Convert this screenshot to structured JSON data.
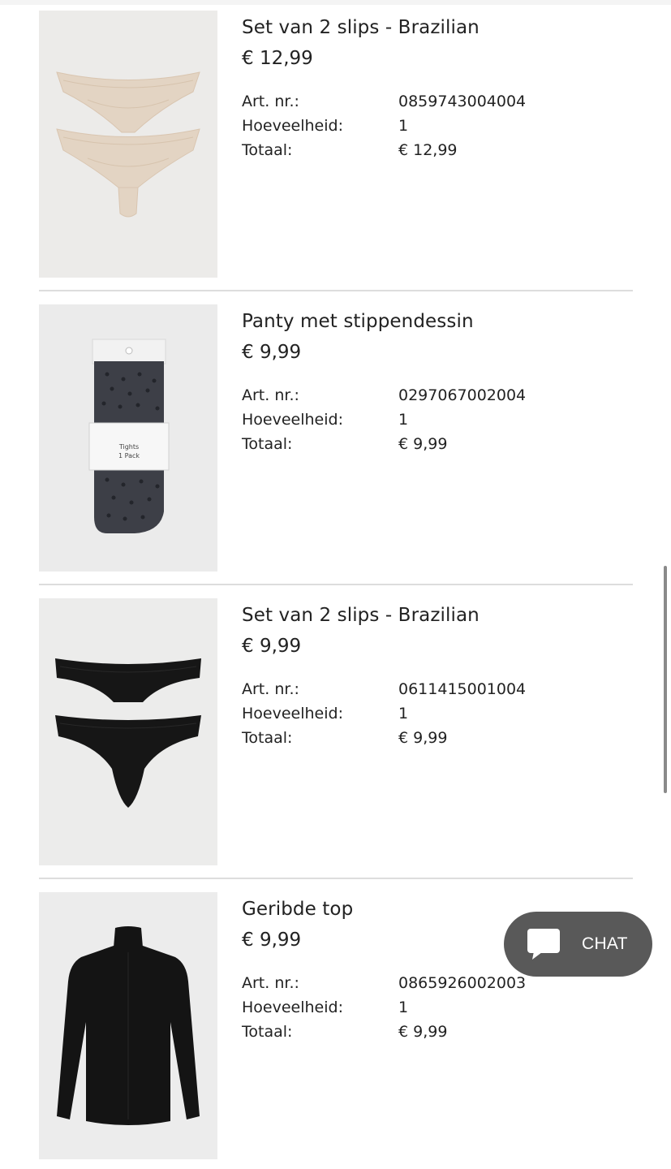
{
  "items": [
    {
      "name": "Set van 2 slips - Brazilian",
      "price": "€ 12,99",
      "art_label": "Art. nr.:",
      "art_value": "0859743004004",
      "qty_label": "Hoeveelheid:",
      "qty_value": "1",
      "total_label": "Totaal:",
      "total_value": "€ 12,99"
    },
    {
      "name": "Panty met stippendessin",
      "price": "€ 9,99",
      "art_label": "Art. nr.:",
      "art_value": "0297067002004",
      "qty_label": "Hoeveelheid:",
      "qty_value": "1",
      "total_label": "Totaal:",
      "total_value": "€ 9,99",
      "pack_label_line1": "Tights",
      "pack_label_line2": "1 Pack"
    },
    {
      "name": "Set van 2 slips - Brazilian",
      "price": "€ 9,99",
      "art_label": "Art. nr.:",
      "art_value": "0611415001004",
      "qty_label": "Hoeveelheid:",
      "qty_value": "1",
      "total_label": "Totaal:",
      "total_value": "€ 9,99"
    },
    {
      "name": "Geribde top",
      "price": "€ 9,99",
      "art_label": "Art. nr.:",
      "art_value": "0865926002003",
      "qty_label": "Hoeveelheid:",
      "qty_value": "1",
      "total_label": "Totaal:",
      "total_value": "€ 9,99"
    }
  ],
  "chat": {
    "label": "CHAT",
    "icon": "chat-bubble-icon"
  },
  "colors": {
    "text": "#222222",
    "divider": "#dddddd",
    "chat_bg": "#595959",
    "thumb_bg": "#ecebea"
  }
}
